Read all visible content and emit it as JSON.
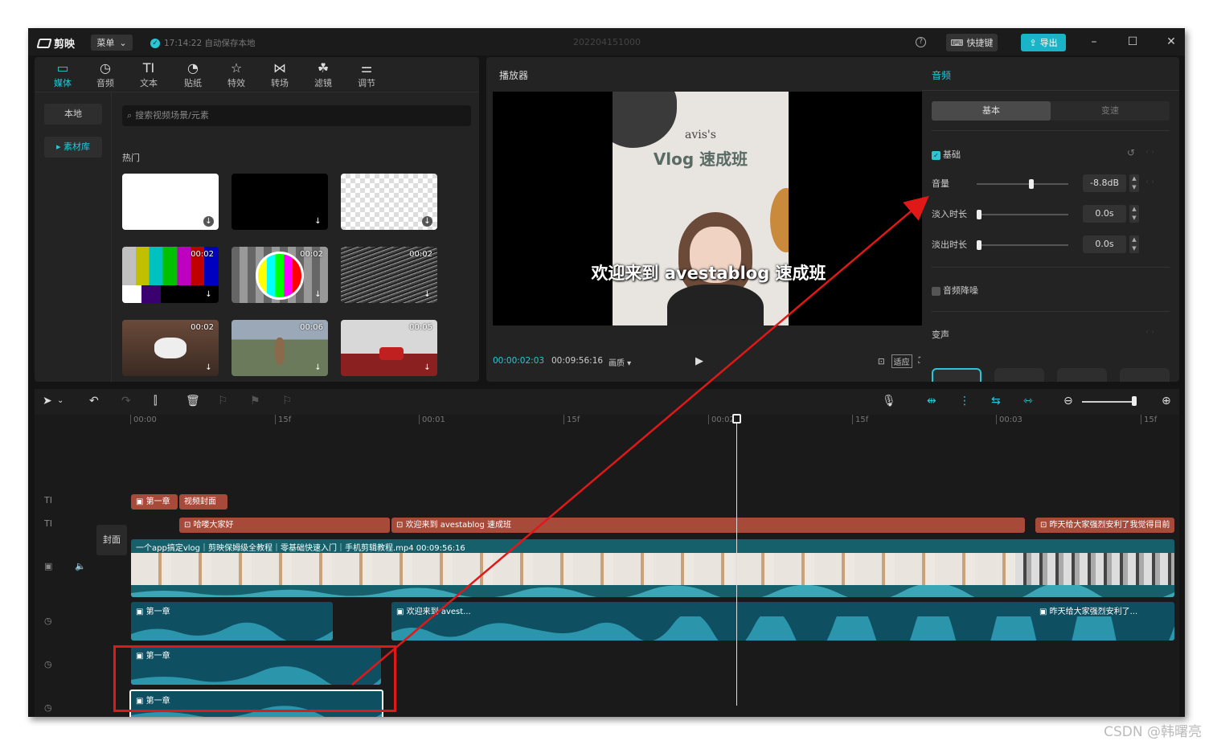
{
  "titlebar": {
    "app_name": "剪映",
    "menu_label": "菜单",
    "autosave": "17:14:22 自动保存本地",
    "project_title": "202204151000",
    "shortcut_label": "快捷键",
    "export_label": "导出"
  },
  "media_panel": {
    "tabs": [
      {
        "label": "媒体",
        "icon": "media-icon"
      },
      {
        "label": "音频",
        "icon": "audio-icon"
      },
      {
        "label": "文本",
        "icon": "text-icon"
      },
      {
        "label": "贴纸",
        "icon": "sticker-icon"
      },
      {
        "label": "特效",
        "icon": "effects-icon"
      },
      {
        "label": "转场",
        "icon": "transition-icon"
      },
      {
        "label": "滤镜",
        "icon": "filter-icon"
      },
      {
        "label": "调节",
        "icon": "adjust-icon"
      }
    ],
    "side": {
      "local": "本地",
      "library": "素材库"
    },
    "search_placeholder": "搜索视频场景/元素",
    "hot_label": "热门",
    "thumbs": [
      {
        "duration": ""
      },
      {
        "duration": ""
      },
      {
        "duration": ""
      },
      {
        "duration": "00:02"
      },
      {
        "duration": "00:02"
      },
      {
        "duration": "00:02"
      },
      {
        "duration": "00:02"
      },
      {
        "duration": "00:06"
      },
      {
        "duration": "00:05"
      }
    ]
  },
  "player": {
    "header": "播放器",
    "video_brand": "avis's",
    "video_title": "Vlog 速成班",
    "subtitle": "欢迎来到 avestablog 速成班",
    "current_time": "00:00:02:03",
    "total_time": "00:09:56:16",
    "quality_label": "画质",
    "fit_label": "适应"
  },
  "audio_panel": {
    "header": "音频",
    "tab_basic": "基本",
    "tab_speed": "变速",
    "section_basic": "基础",
    "volume_label": "音量",
    "volume_value": "-8.8dB",
    "volume_level": 0.6,
    "fade_in_label": "淡入时长",
    "fade_in_value": "0.0s",
    "fade_out_label": "淡出时长",
    "fade_out_value": "0.0s",
    "denoise_label": "音频降噪",
    "voice_change_label": "变声"
  },
  "timeline": {
    "ruler": [
      "00:00",
      "15f",
      "00:01",
      "15f",
      "00:02",
      "15f",
      "00:03",
      "15f"
    ],
    "cover_label": "封面",
    "clips": {
      "t1a": "第一章",
      "t1b": "视频封面",
      "t2a": "哈喽大家好",
      "t2b": "欢迎来到 avestablog 速成班",
      "t2c": "昨天给大家强烈安利了我觉得目前",
      "video": "一个app搞定vlog｜剪映保姆级全教程｜零基础快速入门｜手机剪辑教程.mp4   00:09:56:16",
      "a1a": "第一章",
      "a1b": "欢迎来到 avest...",
      "a1c": "昨天给大家强烈安利了...",
      "a2": "第一章",
      "a3": "第一章"
    }
  },
  "watermark": "CSDN @韩曙亮",
  "colors": {
    "accent": "#2bc6d6",
    "text_clip": "#a84a3a",
    "audio_clip": "#0f4f62",
    "annotation": "#e01818"
  }
}
